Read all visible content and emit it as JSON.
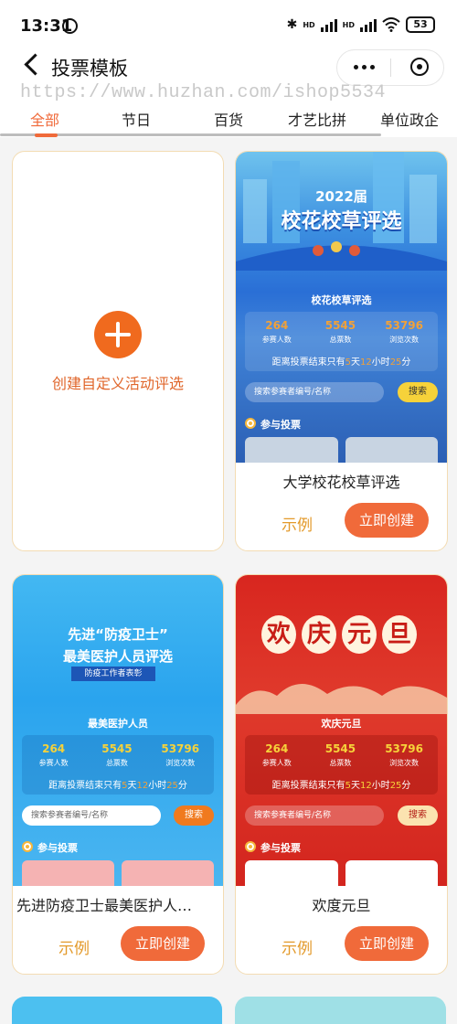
{
  "status_bar": {
    "time": "13:31",
    "hd1": "HD",
    "hd2": "HD",
    "battery": "53"
  },
  "nav": {
    "title": "投票模板"
  },
  "watermark": "https://www.huzhan.com/ishop5534",
  "tabs": [
    "全部",
    "节日",
    "百货",
    "才艺比拼",
    "单位政企"
  ],
  "custom_card": {
    "label": "创建自定义活动评选"
  },
  "templates": [
    {
      "name": "大学校花校草评选",
      "example": "示例",
      "create": "立即创建",
      "poster": {
        "headline_year": "2022届",
        "headline": "校花校草评选",
        "subtitle": "校花校草评选",
        "stats": [
          {
            "value": "264",
            "label": "参赛人数"
          },
          {
            "value": "5545",
            "label": "总票数"
          },
          {
            "value": "53796",
            "label": "浏览次数"
          }
        ],
        "countdown": {
          "prefix": "距离投票结束只有",
          "days": "5",
          "d": "天",
          "hours": "12",
          "h": "小时",
          "minutes": "25",
          "m": "分"
        },
        "search_placeholder": "搜索参赛者编号/名称",
        "search_button": "搜索",
        "vote_heading": "参与投票"
      }
    },
    {
      "name": "先进防疫卫士最美医护人…",
      "example": "示例",
      "create": "立即创建",
      "poster": {
        "headline1": "先进“防疫卫士”",
        "headline2": "最美医护人员评选",
        "tag": "防疫工作者表彰",
        "subtitle": "最美医护人员",
        "stats": [
          {
            "value": "264",
            "label": "参赛人数"
          },
          {
            "value": "5545",
            "label": "总票数"
          },
          {
            "value": "53796",
            "label": "浏览次数"
          }
        ],
        "countdown": {
          "prefix": "距离投票结束只有",
          "days": "5",
          "d": "天",
          "hours": "12",
          "h": "小时",
          "minutes": "25",
          "m": "分"
        },
        "search_placeholder": "搜索参赛者编号/名称",
        "search_button": "搜索",
        "vote_heading": "参与投票"
      }
    },
    {
      "name": "欢度元旦",
      "example": "示例",
      "create": "立即创建",
      "poster": {
        "headline_chars": [
          "欢",
          "庆",
          "元",
          "旦"
        ],
        "subtitle": "欢庆元旦",
        "stats": [
          {
            "value": "264",
            "label": "参赛人数"
          },
          {
            "value": "5545",
            "label": "总票数"
          },
          {
            "value": "53796",
            "label": "浏览次数"
          }
        ],
        "countdown": {
          "prefix": "距离投票结束只有",
          "days": "5",
          "d": "天",
          "hours": "12",
          "h": "小时",
          "minutes": "25",
          "m": "分"
        },
        "search_placeholder": "搜索参赛者编号/名称",
        "search_button": "搜索",
        "vote_heading": "参与投票"
      }
    }
  ],
  "colors": {
    "accent": "#f06a3a",
    "link": "#e39a2b",
    "card_border": "#f3dcb3",
    "stat_number": "#f0a13a"
  }
}
